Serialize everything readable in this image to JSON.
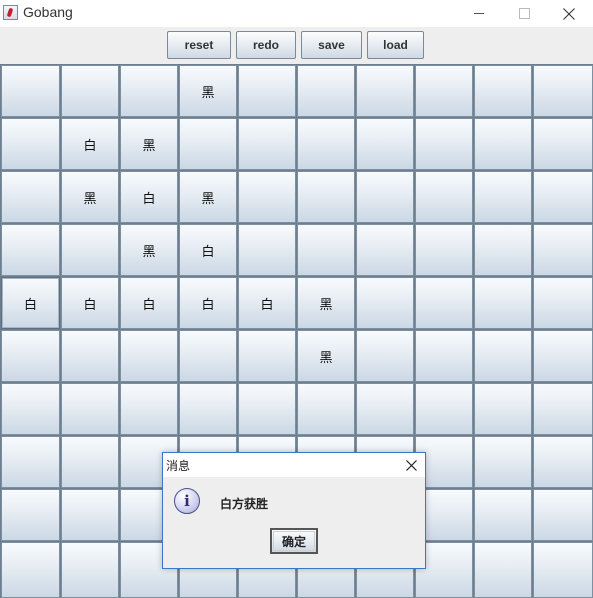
{
  "window": {
    "title": "Gobang"
  },
  "toolbar": {
    "buttons": [
      {
        "id": "reset",
        "label": "reset"
      },
      {
        "id": "redo",
        "label": "redo"
      },
      {
        "id": "save",
        "label": "save"
      },
      {
        "id": "load",
        "label": "load"
      }
    ]
  },
  "board": {
    "rows": 10,
    "cols": 10,
    "cells": [
      [
        "",
        "",
        "",
        "黑",
        "",
        "",
        "",
        "",
        "",
        ""
      ],
      [
        "",
        "白",
        "黑",
        "",
        "",
        "",
        "",
        "",
        "",
        ""
      ],
      [
        "",
        "黑",
        "白",
        "黑",
        "",
        "",
        "",
        "",
        "",
        ""
      ],
      [
        "",
        "",
        "黑",
        "白",
        "",
        "",
        "",
        "",
        "",
        ""
      ],
      [
        "白",
        "白",
        "白",
        "白",
        "白",
        "黑",
        "",
        "",
        "",
        ""
      ],
      [
        "",
        "",
        "",
        "",
        "",
        "黑",
        "",
        "",
        "",
        ""
      ],
      [
        "",
        "",
        "",
        "",
        "",
        "",
        "",
        "",
        "",
        ""
      ],
      [
        "",
        "",
        "",
        "",
        "",
        "",
        "",
        "",
        "",
        ""
      ],
      [
        "",
        "",
        "",
        "",
        "",
        "",
        "",
        "",
        "",
        ""
      ],
      [
        "",
        "",
        "",
        "",
        "",
        "",
        "",
        "",
        "",
        ""
      ]
    ],
    "focused_cell": [
      4,
      0
    ]
  },
  "dialog": {
    "title": "消息",
    "message": "白方获胜",
    "ok_label": "确定",
    "icon": "info-icon"
  }
}
